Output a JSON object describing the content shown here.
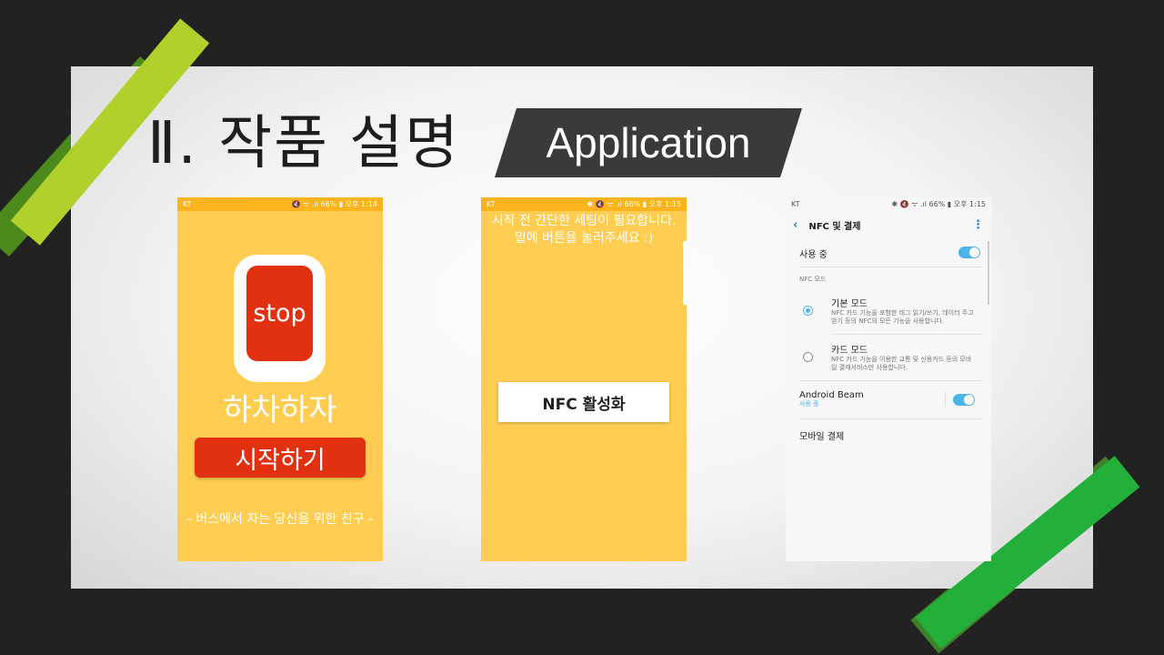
{
  "slide": {
    "title": "Ⅱ. 작품 설명",
    "tag": "Application"
  },
  "phone1": {
    "carrier": "KT",
    "status_right": "🔇 ᯤ .ıl 66% ▮ 오후 1:14",
    "stop_label": "stop",
    "app_name": "하차하자",
    "start_button": "시작하기",
    "tagline": "- 버스에서 자는 당신을 위한 친구 -"
  },
  "phone2": {
    "carrier": "KT",
    "status_right": "✱ 🔇 ᯤ .ıl 66% ▮ 오후 1:15",
    "setup_line1": "시작 전 간단한 세팅이 필요합니다.",
    "setup_line2": "밑에 버튼을 눌러주세요 :)",
    "nfc_button": "NFC 활성화"
  },
  "phone3": {
    "carrier": "KT",
    "status_right": "✱ 🔇 ᯤ .ıl 66% ▮ 오후 1:15",
    "header_title": "NFC 및 결제",
    "in_use_label": "사용 중",
    "section_label": "NFC 모드",
    "default_mode_title": "기본 모드",
    "default_mode_desc": "NFC 카드 기능을 포함한 태그 읽기/쓰기, 데이터 주고 받기 등의 NFC의 모든 기능을 사용합니다.",
    "card_mode_title": "카드 모드",
    "card_mode_desc": "NFC 카드 기능을 이용한 교통 및 신용카드 등의 모바일 결제서비스만 사용합니다.",
    "beam_title": "Android Beam",
    "beam_status": "사용 중",
    "mobile_pay": "모바일 결제"
  },
  "colors": {
    "accent_yellow": "#fecd52",
    "accent_red": "#e23111",
    "toggle_blue": "#4cb5e6",
    "tape_lime": "#b0d12c",
    "tape_green": "#23b03a"
  },
  "icons": [
    "back-arrow-icon",
    "more-options-icon",
    "radio-icon",
    "toggle-icon"
  ]
}
